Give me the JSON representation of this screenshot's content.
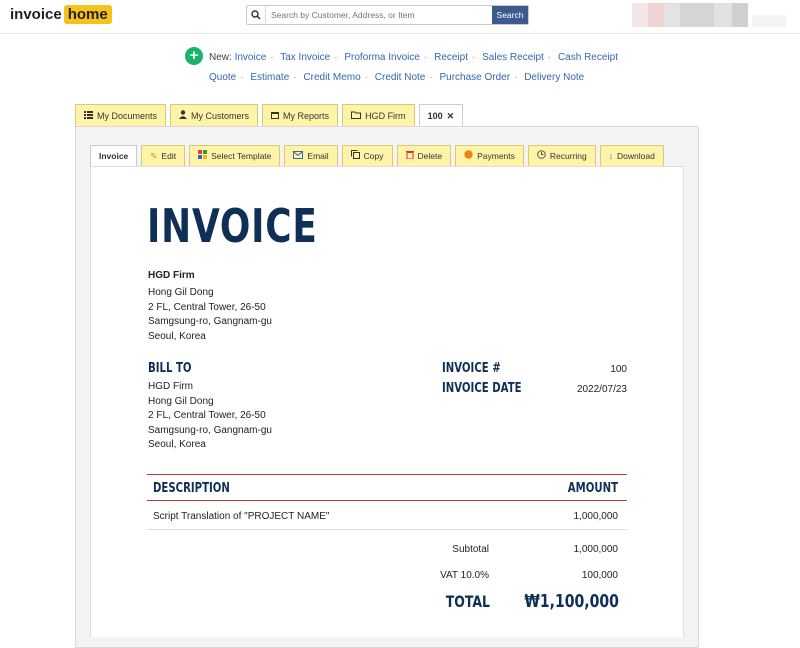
{
  "brand": {
    "name_part1": "invoice",
    "name_part2": "home"
  },
  "search": {
    "placeholder": "Search by Customer, Address, or Item",
    "button_label": "Search"
  },
  "new_doc": {
    "prefix": "New:",
    "row1": [
      "Invoice",
      "Tax Invoice",
      "Proforma Invoice",
      "Receipt",
      "Sales Receipt",
      "Cash Receipt"
    ],
    "row2": [
      "Quote",
      "Estimate",
      "Credit Memo",
      "Credit Note",
      "Purchase Order",
      "Delivery Note"
    ]
  },
  "doc_tabs": [
    {
      "label": "My Documents",
      "icon": "list-icon"
    },
    {
      "label": "My Customers",
      "icon": "user-icon"
    },
    {
      "label": "My Reports",
      "icon": "calendar-icon"
    },
    {
      "label": "HGD Firm",
      "icon": "folder-icon"
    },
    {
      "label": "100",
      "icon": "close-icon",
      "active": true
    }
  ],
  "actions": [
    {
      "label": "Invoice",
      "active": true
    },
    {
      "label": "Edit",
      "icon": "pencil-icon"
    },
    {
      "label": "Select Template",
      "icon": "grid-icon"
    },
    {
      "label": "Email",
      "icon": "email-icon"
    },
    {
      "label": "Copy",
      "icon": "copy-icon"
    },
    {
      "label": "Delete",
      "icon": "trash-icon"
    },
    {
      "label": "Payments",
      "icon": "coin-icon"
    },
    {
      "label": "Recurring",
      "icon": "clock-icon"
    },
    {
      "label": "Download",
      "icon": "download-icon"
    }
  ],
  "invoice": {
    "title": "INVOICE",
    "from": {
      "company": "HGD Firm",
      "lines": [
        "Hong Gil Dong",
        "2 FL, Central Tower, 26-50",
        "Samgsung-ro, Gangnam-gu",
        "Seoul, Korea"
      ]
    },
    "bill_to_label": "BILL TO",
    "bill_to": [
      "HGD Firm",
      "Hong Gil Dong",
      "2 FL, Central Tower, 26-50",
      "Samgsung-ro, Gangnam-gu",
      "Seoul, Korea"
    ],
    "number_label": "INVOICE #",
    "number": "100",
    "date_label": "INVOICE DATE",
    "date": "2022/07/23",
    "col_description": "DESCRIPTION",
    "col_amount": "AMOUNT",
    "items": [
      {
        "description": "Script Translation of \"PROJECT NAME\"",
        "amount": "1,000,000"
      }
    ],
    "subtotal_label": "Subtotal",
    "subtotal": "1,000,000",
    "vat_label": "VAT 10.0%",
    "vat": "100,000",
    "total_label": "TOTAL",
    "total": "₩1,100,000"
  },
  "colors": {
    "accent_yellow": "#fdf4a8",
    "brand_yellow": "#f7c21b",
    "navy": "#0f2f57",
    "link_blue": "#3467b2",
    "search_button": "#3b5b8f",
    "rule_red": "#c93535",
    "new_green": "#1bb26a"
  }
}
